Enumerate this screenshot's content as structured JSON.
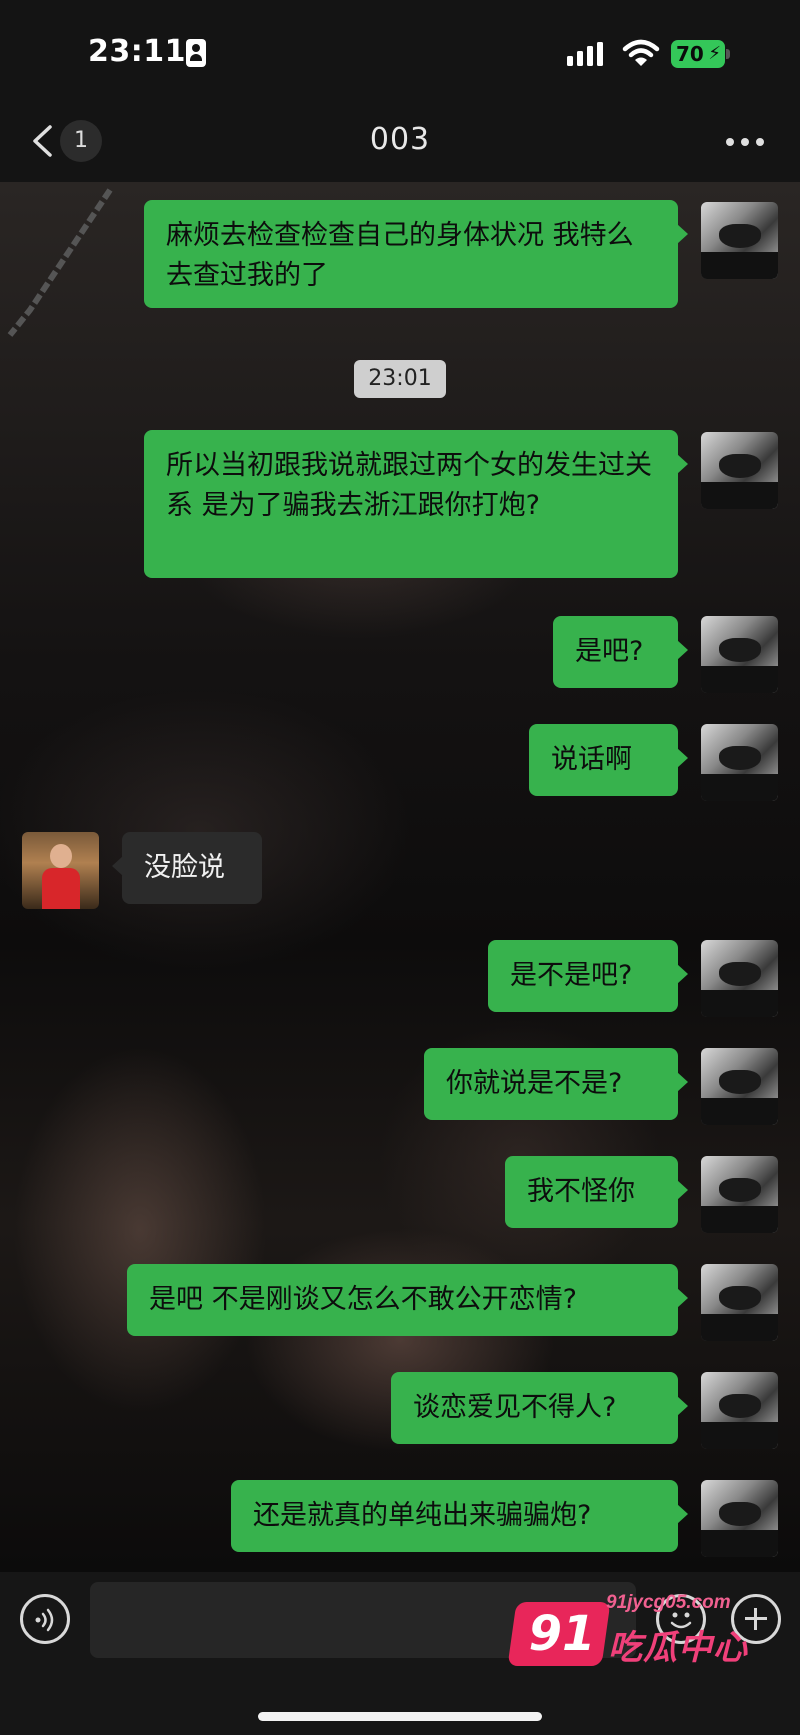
{
  "status_bar": {
    "time": "23:11",
    "battery": "70"
  },
  "nav": {
    "unread_count": "1",
    "title": "003"
  },
  "timestamp": "23:01",
  "messages": [
    {
      "side": "out",
      "text": "麻烦去检查检查自己的身体状况 我特么去查过我的了"
    },
    {
      "side": "out",
      "text": "所以当初跟我说就跟过两个女的发生过关系 是为了骗我去浙江跟你打炮?"
    },
    {
      "side": "out",
      "text": "是吧?"
    },
    {
      "side": "out",
      "text": "说话啊"
    },
    {
      "side": "in",
      "text": "没脸说"
    },
    {
      "side": "out",
      "text": "是不是吧?"
    },
    {
      "side": "out",
      "text": "你就说是不是?"
    },
    {
      "side": "out",
      "text": "我不怪你"
    },
    {
      "side": "out",
      "text": "是吧 不是刚谈又怎么不敢公开恋情?"
    },
    {
      "side": "out",
      "text": "谈恋爱见不得人?"
    },
    {
      "side": "out",
      "text": "还是就真的单纯出来骗骗炮?"
    }
  ],
  "input": {
    "value": ""
  },
  "watermark": {
    "number": "91",
    "domain": "91jycg05.com",
    "name": "吃瓜中心"
  },
  "colors": {
    "bubble_out": "#37b24d",
    "bubble_in": "#2b2b2b",
    "battery": "#34c759",
    "watermark": "#e8265a"
  }
}
